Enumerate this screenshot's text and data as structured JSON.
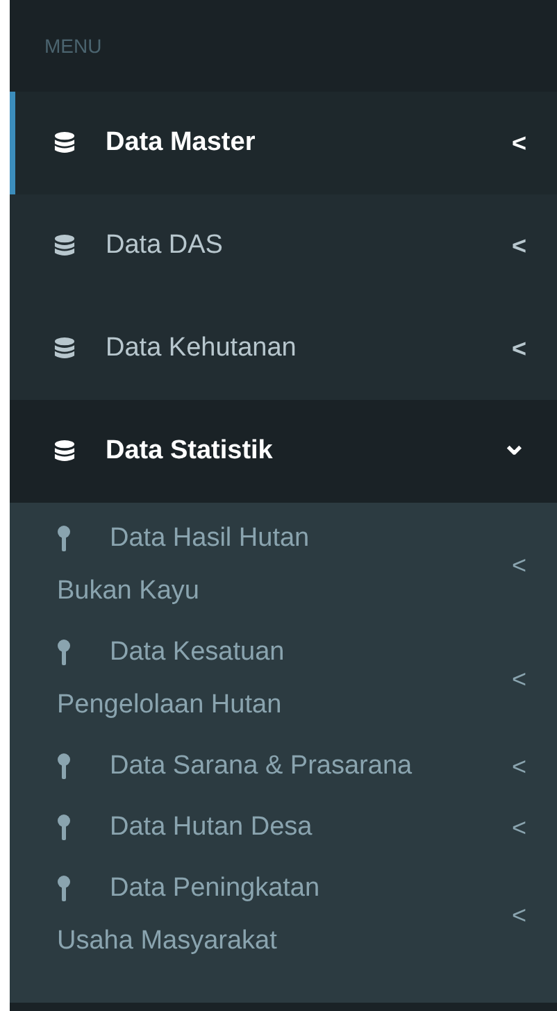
{
  "header": "MENU",
  "items": [
    {
      "label": "Data Master",
      "selected": true,
      "expanded": false,
      "chevron": "<"
    },
    {
      "label": "Data DAS",
      "selected": false,
      "expanded": false,
      "chevron": "<"
    },
    {
      "label": "Data Kehutanan",
      "selected": false,
      "expanded": false,
      "chevron": "<"
    },
    {
      "label": "Data Statistik",
      "selected": false,
      "expanded": true,
      "chevron": "⌄",
      "children": [
        {
          "lines": [
            "Data Hasil Hutan",
            "Bukan Kayu"
          ],
          "chevron": "<"
        },
        {
          "lines": [
            "Data Kesatuan",
            "Pengelolaan Hutan"
          ],
          "chevron": "<"
        },
        {
          "lines": [
            "Data Sarana & Prasarana"
          ],
          "chevron": "<"
        },
        {
          "lines": [
            "Data Hutan Desa"
          ],
          "chevron": "<"
        },
        {
          "lines": [
            "Data Peningkatan",
            "Usaha Masyarakat"
          ],
          "chevron": "<"
        }
      ]
    }
  ]
}
